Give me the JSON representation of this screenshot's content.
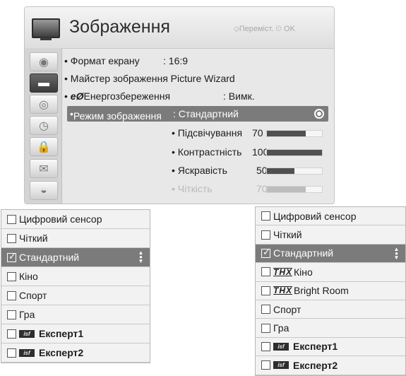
{
  "menu": {
    "title": "Зображення",
    "nav_hint_move": "Переміст.",
    "nav_hint_ok": "OK",
    "sidebar": [
      "disc-icon",
      "tv-icon",
      "speaker-icon",
      "clock-icon",
      "lock-icon",
      "options-icon",
      "support-icon"
    ],
    "items": {
      "screen_format_label": "Формат екрану",
      "screen_format_value": ": 16:9",
      "wizard_label": "Майстер зображення Picture Wizard",
      "energy_prefix": "eØ",
      "energy_label": "Енергозбереження",
      "energy_value": ": Вимк.",
      "mode_label": "Режим зображення",
      "mode_value": ": Стандартний"
    },
    "sub": [
      {
        "label": "Підсвічування",
        "value": "70",
        "level": 0.7
      },
      {
        "label": "Контрастність",
        "value": "100",
        "level": 1.0
      },
      {
        "label": "Яскравість",
        "value": "50",
        "level": 0.5
      },
      {
        "label": "Чіткість",
        "value": "70",
        "level": 0.7
      }
    ]
  },
  "list_left": [
    {
      "label": "Цифровий сенсор"
    },
    {
      "label": "Чіткий"
    },
    {
      "label": "Стандартний",
      "checked": true
    },
    {
      "label": "Кіно"
    },
    {
      "label": "Спорт"
    },
    {
      "label": "Гра"
    },
    {
      "label": "Експерт1",
      "isf": true
    },
    {
      "label": "Експерт2",
      "isf": true
    }
  ],
  "list_right": [
    {
      "label": "Цифровий сенсор"
    },
    {
      "label": "Чіткий"
    },
    {
      "label": "Стандартний",
      "checked": true
    },
    {
      "label": "Кіно",
      "thx": true
    },
    {
      "label": "Bright Room",
      "thx": true
    },
    {
      "label": "Спорт"
    },
    {
      "label": "Гра"
    },
    {
      "label": "Експерт1",
      "isf": true
    },
    {
      "label": "Експерт2",
      "isf": true
    }
  ],
  "logos": {
    "thx": "THX",
    "isf": "isf"
  }
}
